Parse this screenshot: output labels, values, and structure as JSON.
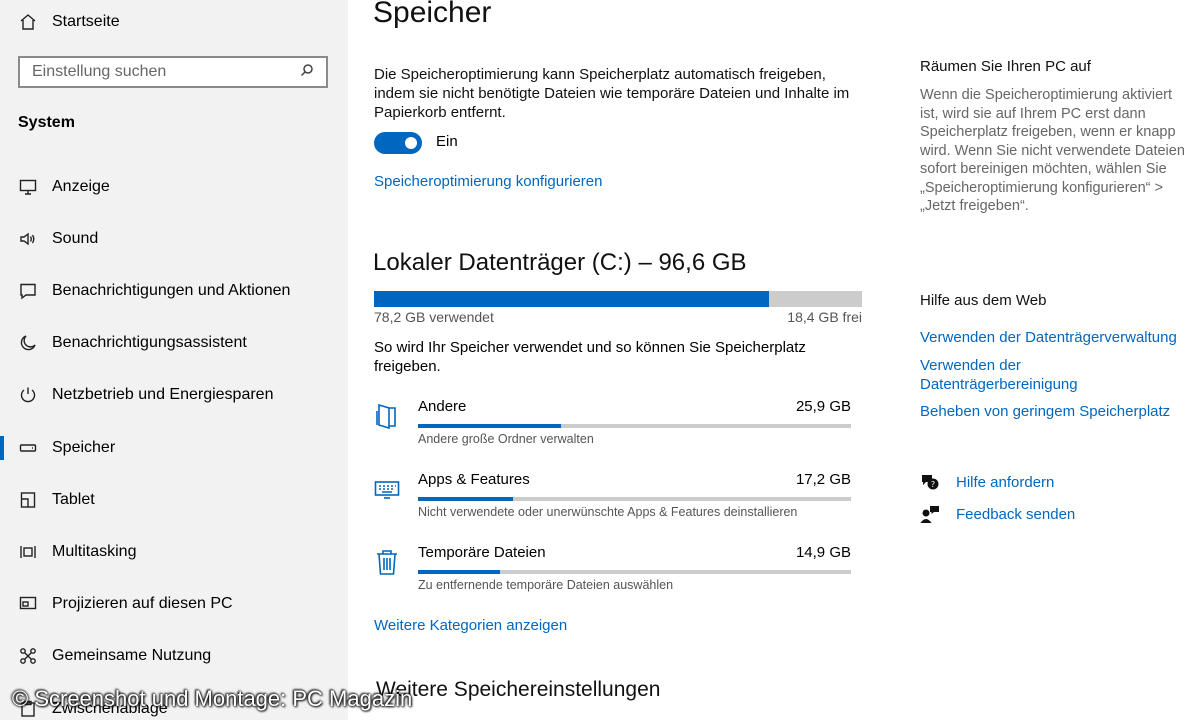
{
  "sidebar": {
    "home_label": "Startseite",
    "search_placeholder": "Einstellung suchen",
    "section_title": "System",
    "items": [
      {
        "label": "Anzeige",
        "icon": "monitor-icon"
      },
      {
        "label": "Sound",
        "icon": "speaker-icon"
      },
      {
        "label": "Benachrichtigungen und Aktionen",
        "icon": "notification-icon"
      },
      {
        "label": "Benachrichtigungsassistent",
        "icon": "moon-icon"
      },
      {
        "label": "Netzbetrieb und Energiesparen",
        "icon": "power-icon"
      },
      {
        "label": "Speicher",
        "icon": "storage-icon"
      },
      {
        "label": "Tablet",
        "icon": "tablet-icon"
      },
      {
        "label": "Multitasking",
        "icon": "multitasking-icon"
      },
      {
        "label": "Projizieren auf diesen PC",
        "icon": "project-icon"
      },
      {
        "label": "Gemeinsame Nutzung",
        "icon": "shared-experiences-icon"
      },
      {
        "label": "Zwischenablage",
        "icon": "clipboard-icon"
      }
    ],
    "active_item": "Speicher"
  },
  "main": {
    "title": "Speicher",
    "description": "Die Speicheroptimierung kann Speicherplatz automatisch freigeben, indem sie nicht benötigte Dateien wie temporäre Dateien und Inhalte im Papierkorb entfernt.",
    "toggle_label": "Ein",
    "toggle_on": true,
    "config_link": "Speicheroptimierung konfigurieren",
    "disk": {
      "title": "Lokaler Datenträger (C:) – 96,6 GB",
      "used_label": "78,2 GB verwendet",
      "free_label": "18,4 GB frei",
      "used_fraction": 0.81
    },
    "usage_text": "So wird Ihr Speicher verwendet und so können Sie Speicherplatz freigeben.",
    "categories": [
      {
        "name": "Andere",
        "size": "25,9 GB",
        "sub": "Andere große Ordner verwalten",
        "fraction": 0.33,
        "icon": "folder-icon"
      },
      {
        "name": "Apps & Features",
        "size": "17,2 GB",
        "sub": "Nicht verwendete oder unerwünschte Apps & Features deinstallieren",
        "fraction": 0.22,
        "icon": "keyboard-icon"
      },
      {
        "name": "Temporäre Dateien",
        "size": "14,9 GB",
        "sub": "Zu entfernende temporäre Dateien auswählen",
        "fraction": 0.19,
        "icon": "trash-icon"
      }
    ],
    "more_link": "Weitere Kategorien anzeigen",
    "more_settings_title": "Weitere Speichereinstellungen"
  },
  "right": {
    "cleanup_title": "Räumen Sie Ihren PC auf",
    "cleanup_text": "Wenn die Speicheroptimierung aktiviert ist, wird sie auf Ihrem PC erst dann Speicherplatz freigeben, wenn er knapp wird. Wenn Sie nicht verwendete Dateien sofort bereinigen möchten, wählen Sie „Speicheroptimierung konfigurieren“ > „Jetzt freigeben“.",
    "web_help_title": "Hilfe aus dem Web",
    "web_links": [
      "Verwenden der Datenträgerverwaltung",
      "Verwenden der Datenträgerbereinigung",
      "Beheben von geringem Speicherplatz"
    ],
    "get_help": "Hilfe anfordern",
    "feedback": "Feedback senden"
  },
  "watermark": "© Screenshot und Montage: PC Magazin",
  "colors": {
    "accent": "#0067c0",
    "sidebar_bg": "#f2f2f2",
    "bar_track": "#cccccc"
  }
}
